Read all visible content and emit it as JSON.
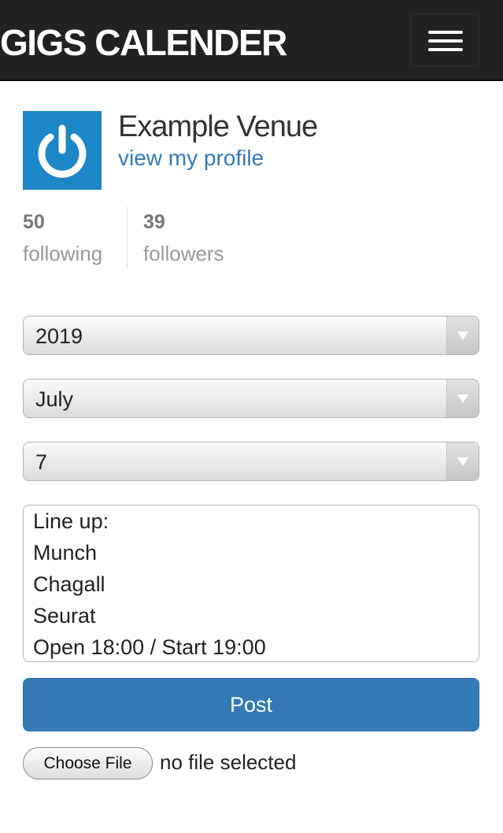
{
  "header": {
    "brand": "GIGS CALENDER",
    "menu_icon": "hamburger-menu-icon"
  },
  "profile": {
    "avatar_icon": "power-icon",
    "name": "Example Venue",
    "link_label": "view my profile"
  },
  "stats": {
    "following_count": "50",
    "following_label": "following",
    "followers_count": "39",
    "followers_label": "followers"
  },
  "form": {
    "year": {
      "selected": "2019"
    },
    "month": {
      "selected": "July"
    },
    "day": {
      "selected": "7"
    },
    "description_lines": [
      "Line up:",
      "Munch",
      "Chagall",
      "Seurat",
      "Open 18:00 / Start 19:00"
    ],
    "post_label": "Post",
    "file_button_label": "Choose File",
    "file_status": "no file selected"
  },
  "colors": {
    "navbar": "#222222",
    "link": "#337ab7",
    "primary_button": "#337ab7",
    "avatar_bg": "#1c86c6"
  }
}
